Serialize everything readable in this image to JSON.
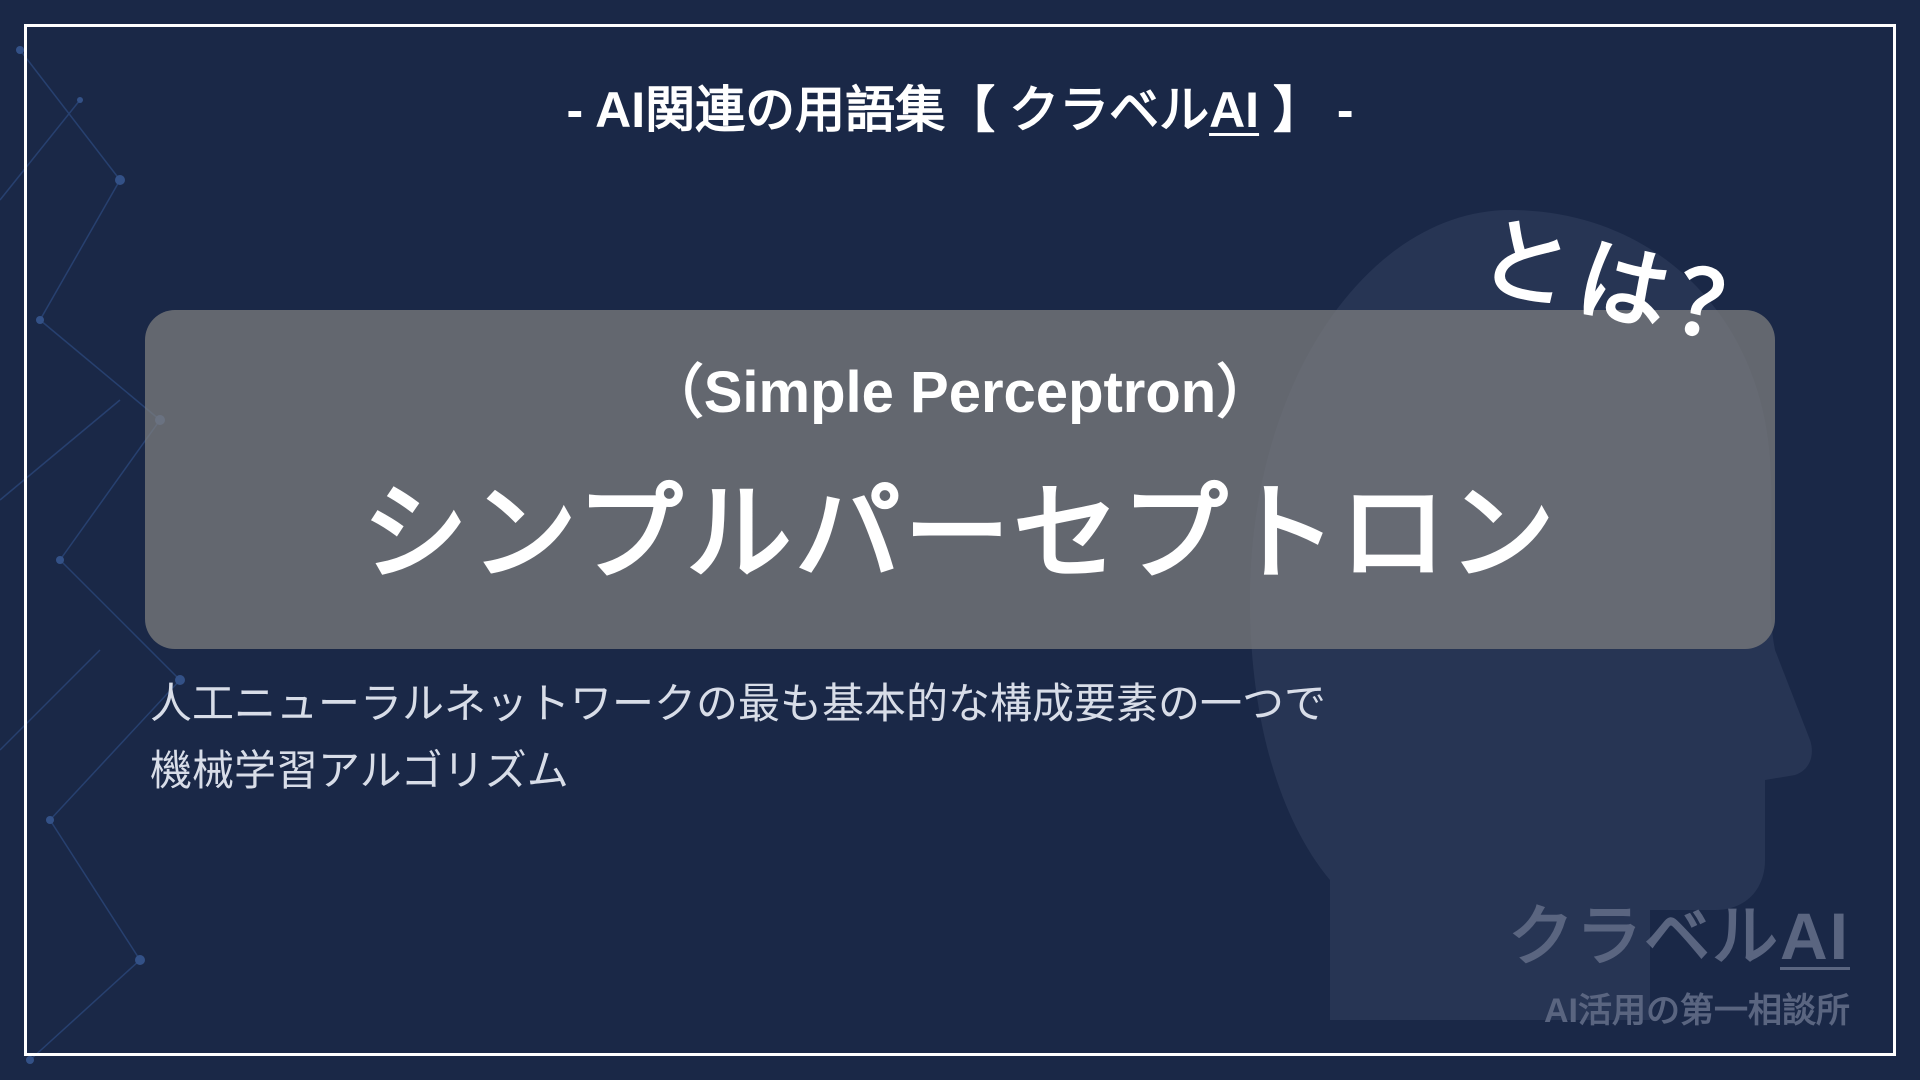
{
  "header": {
    "prefix": "- ",
    "main": "AI関連の用語集",
    "bracket_open": "【 ",
    "brand_part1": "クラベル",
    "brand_part2": "AI",
    "bracket_close": " 】",
    "suffix": " -"
  },
  "annotation": {
    "toha": "とは？"
  },
  "term": {
    "english": "（Simple Perceptron）",
    "japanese": "シンプルパーセプトロン"
  },
  "description": {
    "line1": "人工ニューラルネットワークの最も基本的な構成要素の一つで",
    "line2": "機械学習アルゴリズム"
  },
  "brand": {
    "name_part1": "クラベル",
    "name_part2": "AI",
    "tagline": "AI活用の第一相談所"
  }
}
